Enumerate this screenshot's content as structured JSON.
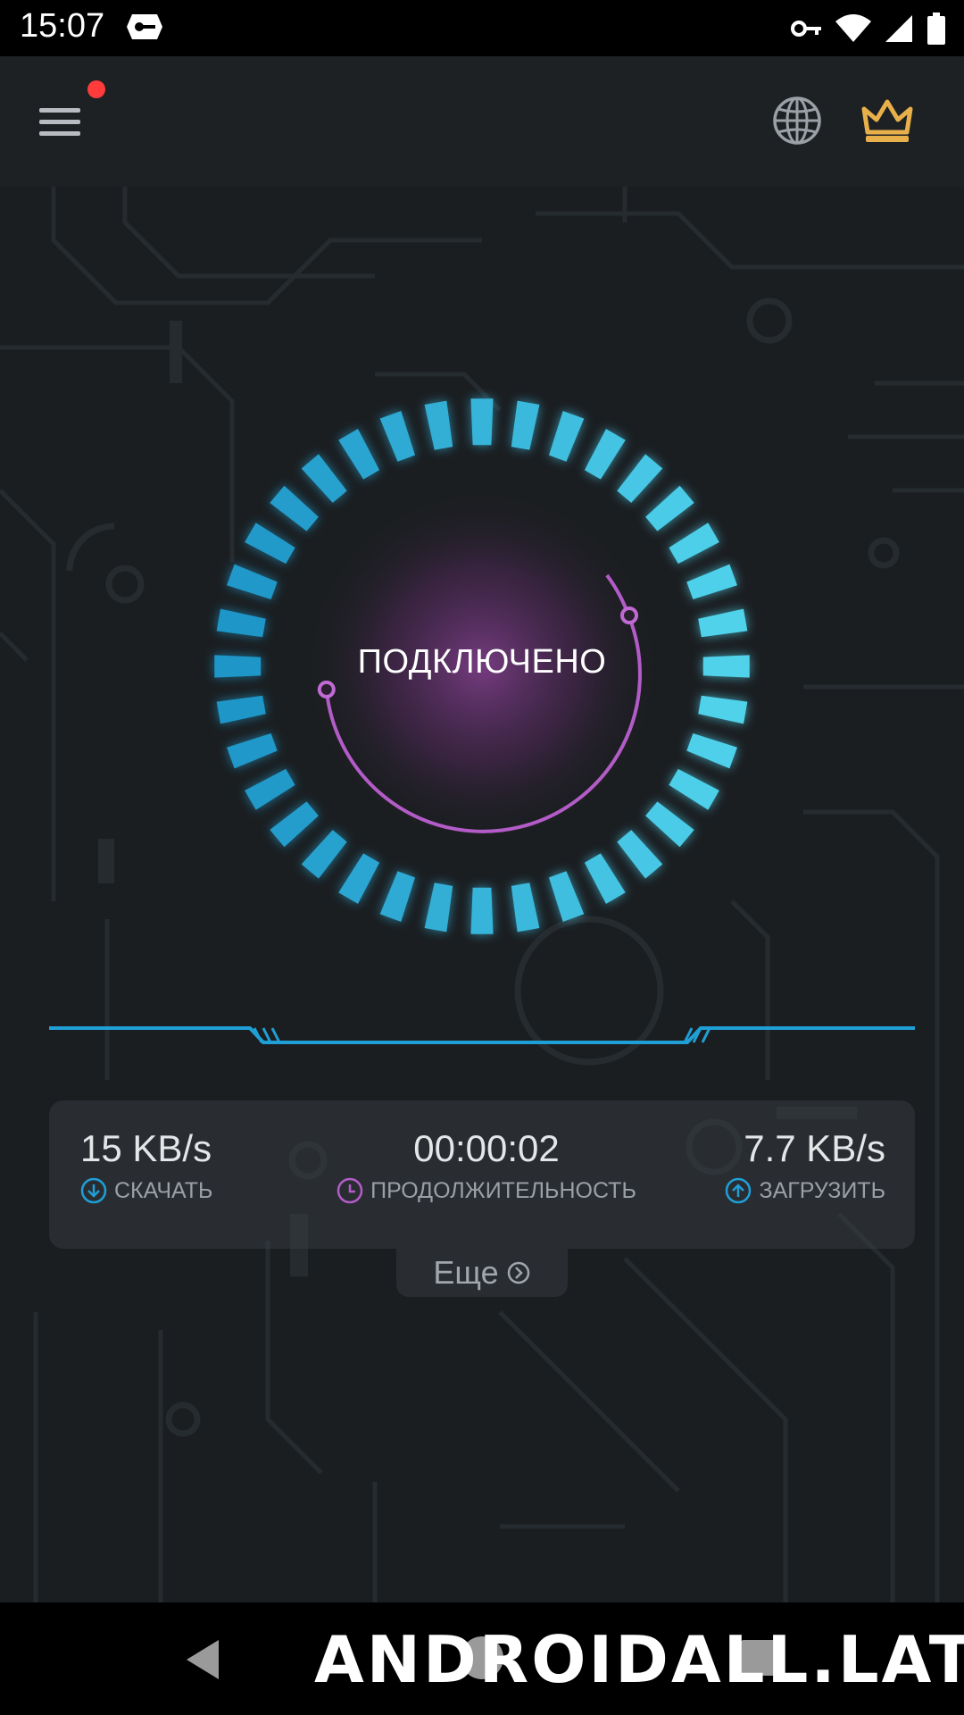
{
  "status_bar": {
    "time": "15:07",
    "icons": [
      "vpn-app-icon",
      "key-icon",
      "wifi-icon",
      "signal-icon",
      "battery-icon"
    ]
  },
  "app_bar": {
    "menu_icon": "menu-icon",
    "has_notification_dot": true,
    "globe_icon": "globe-icon",
    "crown_icon": "crown-icon"
  },
  "connection": {
    "status": "ПОДКЛЮЧЕНО"
  },
  "stats": {
    "download": {
      "value": "15 KB/s",
      "label": "СКАЧАТЬ"
    },
    "duration": {
      "value": "00:00:02",
      "label": "ПРОДОЛЖИТЕЛЬНОСТЬ"
    },
    "upload": {
      "value": "7.7 KB/s",
      "label": "ЗАГРУЗИТЬ"
    }
  },
  "more": {
    "label": "Еще"
  },
  "nav": {
    "icons": [
      "back-icon",
      "home-icon",
      "recents-icon"
    ]
  },
  "watermark": {
    "text": "ANDROIDALL.LAT"
  },
  "colors": {
    "accent_blue": "#2ab8e6",
    "accent_purple": "#b35cc8",
    "crown_gold": "#e8b04a",
    "notification_red": "#ff3b3b"
  }
}
